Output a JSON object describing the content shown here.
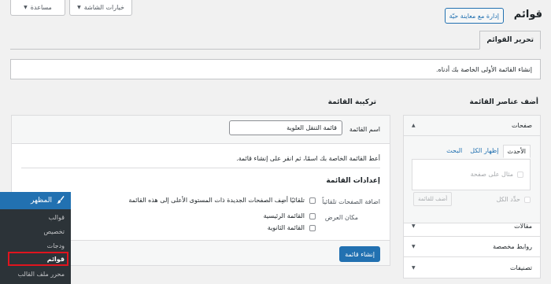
{
  "screen_meta": {
    "screen_options": "خيارات الشاشة",
    "help": "مساعدة"
  },
  "header": {
    "title": "قوائم",
    "live_preview_button": "إدارة مع معاينة حيّة"
  },
  "tabs": [
    {
      "label": "تحرير القوائم",
      "active": true
    }
  ],
  "notice": "إنشاء القائمة الأولى الخاصة بك أدناه.",
  "add_items": {
    "heading": "أضف عناصر القائمة",
    "sections": [
      {
        "label": "صفحات",
        "expanded": true
      },
      {
        "label": "مقالات",
        "expanded": false
      },
      {
        "label": "روابط مخصصة",
        "expanded": false
      },
      {
        "label": "تصنيفات",
        "expanded": false
      }
    ],
    "pages_tabs": [
      "الأحدث",
      "إظهار الكل",
      "البحث"
    ],
    "no_items_text": "مثال على صفحة",
    "select_all": "حدِّد الكل",
    "add_to_menu_button": "أضف للقائمة"
  },
  "menu_structure": {
    "heading": "تركيبة القائمة",
    "name_label": "اسم القائمة",
    "name_value": "قائمة التنقل العلوية",
    "instructions": "أعط القائمة الخاصة بك اسمًا، ثم انقر على إنشاء قائمة.",
    "settings_title": "إعدادات القائمة",
    "auto_add_label": "اضافة الصفحات تلقائياً",
    "auto_add_option": "تلقائيًا أضِف الصفحات الجديدة ذات المستوى الأعلى إلى هذه القائمة",
    "display_location_label": "مكان العرض",
    "locations": [
      "القائمة الرئيسية",
      "القائمة الثانوية"
    ],
    "create_button": "إنشاء قائمة"
  },
  "sidebar": {
    "parent": "المظهر",
    "items": [
      "قوالب",
      "تخصيص",
      "ودجات",
      "قوائم",
      "محرر ملف القالب"
    ],
    "current": "قوائم"
  },
  "colors": {
    "accent": "#2271b1",
    "highlight": "#e0141e",
    "sidebar_bg": "#2c3338"
  }
}
